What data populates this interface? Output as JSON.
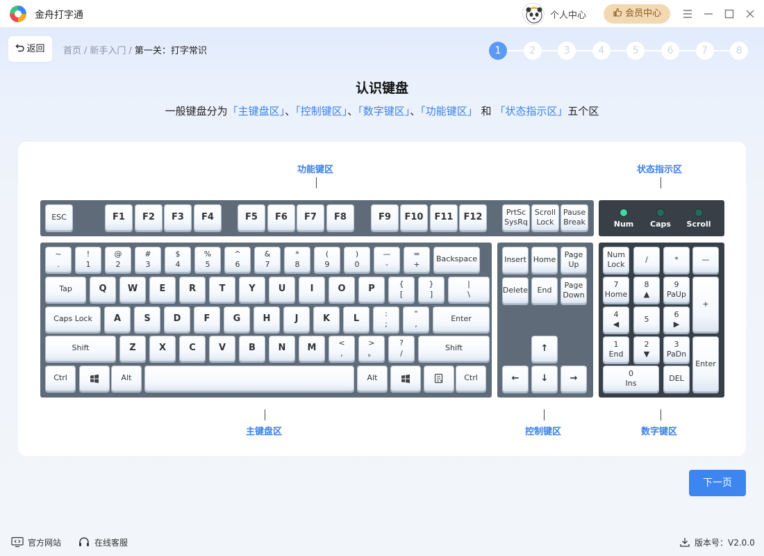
{
  "app": {
    "title": "金舟打字通"
  },
  "header": {
    "personal_label": "个人中心",
    "vip_label": "会员中心"
  },
  "nav": {
    "back_label": "返回",
    "breadcrumb": [
      "首页",
      "新手入门",
      "第一关：打字常识"
    ],
    "separator": "/",
    "steps": [
      "1",
      "2",
      "3",
      "4",
      "5",
      "6",
      "7",
      "8"
    ],
    "active_step": 1
  },
  "content": {
    "title": "认识键盘",
    "subtitle_parts": [
      {
        "text": "一般键盘分为",
        "hl": false
      },
      {
        "text": "「主键盘区」",
        "hl": true
      },
      {
        "text": "、",
        "hl": false
      },
      {
        "text": "「控制键区」",
        "hl": true
      },
      {
        "text": "、",
        "hl": false
      },
      {
        "text": "「数字键区」",
        "hl": true
      },
      {
        "text": "、",
        "hl": false
      },
      {
        "text": "「功能键区」",
        "hl": true
      },
      {
        "text": " 和 ",
        "hl": false
      },
      {
        "text": "「状态指示区」",
        "hl": true
      },
      {
        "text": "五个区",
        "hl": false
      }
    ]
  },
  "zones": {
    "function": "功能键区",
    "status": "状态指示区",
    "main": "主键盘区",
    "control": "控制键区",
    "numpad": "数字键区"
  },
  "keyboard": {
    "function_row": [
      [
        "ESC"
      ],
      [
        "F1"
      ],
      [
        "F2"
      ],
      [
        "F3"
      ],
      [
        "F4"
      ],
      [
        "F5"
      ],
      [
        "F6"
      ],
      [
        "F7"
      ],
      [
        "F8"
      ],
      [
        "F9"
      ],
      [
        "F10"
      ],
      [
        "F11"
      ],
      [
        "F12"
      ],
      [
        "PrtSc",
        "SysRq"
      ],
      [
        "Scroll",
        "Lock"
      ],
      [
        "Pause",
        "Break"
      ]
    ],
    "leds": [
      "Num",
      "Caps",
      "Scroll"
    ],
    "row1": [
      [
        "~",
        "."
      ],
      [
        "!",
        "1"
      ],
      [
        "@",
        "2"
      ],
      [
        "#",
        "3"
      ],
      [
        "$",
        "4"
      ],
      [
        "%",
        "5"
      ],
      [
        "^",
        "6"
      ],
      [
        "&",
        "7"
      ],
      [
        "*",
        "8"
      ],
      [
        "(",
        "9"
      ],
      [
        ")",
        "0"
      ],
      [
        "—",
        "-"
      ],
      [
        "=",
        "+"
      ],
      [
        "Backspace"
      ]
    ],
    "row2": [
      [
        "Tap"
      ],
      [
        "Q"
      ],
      [
        "W"
      ],
      [
        "E"
      ],
      [
        "R"
      ],
      [
        "T"
      ],
      [
        "Y"
      ],
      [
        "U"
      ],
      [
        "I"
      ],
      [
        "O"
      ],
      [
        "P"
      ],
      [
        "{",
        "["
      ],
      [
        "}",
        "]"
      ],
      [
        "|",
        "\\"
      ]
    ],
    "row3": [
      [
        "Caps Lock"
      ],
      [
        "A"
      ],
      [
        "S"
      ],
      [
        "D"
      ],
      [
        "F"
      ],
      [
        "G"
      ],
      [
        "H"
      ],
      [
        "J"
      ],
      [
        "K"
      ],
      [
        "L"
      ],
      [
        ":",
        ";"
      ],
      [
        "\"",
        ","
      ],
      [
        "Enter"
      ]
    ],
    "row4": [
      [
        "Shift"
      ],
      [
        "Z"
      ],
      [
        "X"
      ],
      [
        "C"
      ],
      [
        "V"
      ],
      [
        "B"
      ],
      [
        "N"
      ],
      [
        "M"
      ],
      [
        "<",
        ","
      ],
      [
        ">",
        "。"
      ],
      [
        "?",
        "/"
      ],
      [
        "Shift"
      ]
    ],
    "row5": [
      [
        "Ctrl"
      ],
      [
        "win"
      ],
      [
        "Alt"
      ],
      [
        ""
      ],
      [
        "Alt"
      ],
      [
        "win"
      ],
      [
        "menu"
      ],
      [
        "Ctrl"
      ]
    ],
    "control": [
      [
        "Insert"
      ],
      [
        "Home"
      ],
      [
        "Page",
        "Up"
      ],
      [
        "Delete"
      ],
      [
        "End"
      ],
      [
        "Page",
        "Down"
      ],
      [
        "↑"
      ],
      [
        "←"
      ],
      [
        "↓"
      ],
      [
        "→"
      ]
    ],
    "numpad": [
      [
        "Num",
        "Lock"
      ],
      [
        "/"
      ],
      [
        "*"
      ],
      [
        "—"
      ],
      [
        "7",
        "Home"
      ],
      [
        "8",
        "▲"
      ],
      [
        "9",
        "PaUp"
      ],
      [
        "+"
      ],
      [
        "4",
        "◀"
      ],
      [
        "5"
      ],
      [
        "6",
        "▶"
      ],
      [
        "1",
        "End"
      ],
      [
        "2",
        "▼"
      ],
      [
        "3",
        "PaDn"
      ],
      [
        "Enter"
      ],
      [
        "0",
        "Ins"
      ],
      [
        "DEL"
      ]
    ]
  },
  "footer": {
    "website": "官方网站",
    "support": "在线客服",
    "version": "版本号：V2.0.0"
  },
  "actions": {
    "next_label": "下一页"
  },
  "colors": {
    "accent": "#3d86f0",
    "highlight": "#3a82e8",
    "vip_bg": "#f2d9b3",
    "led_on": "#3fd9a0",
    "led_off": "#1f6e5a"
  }
}
